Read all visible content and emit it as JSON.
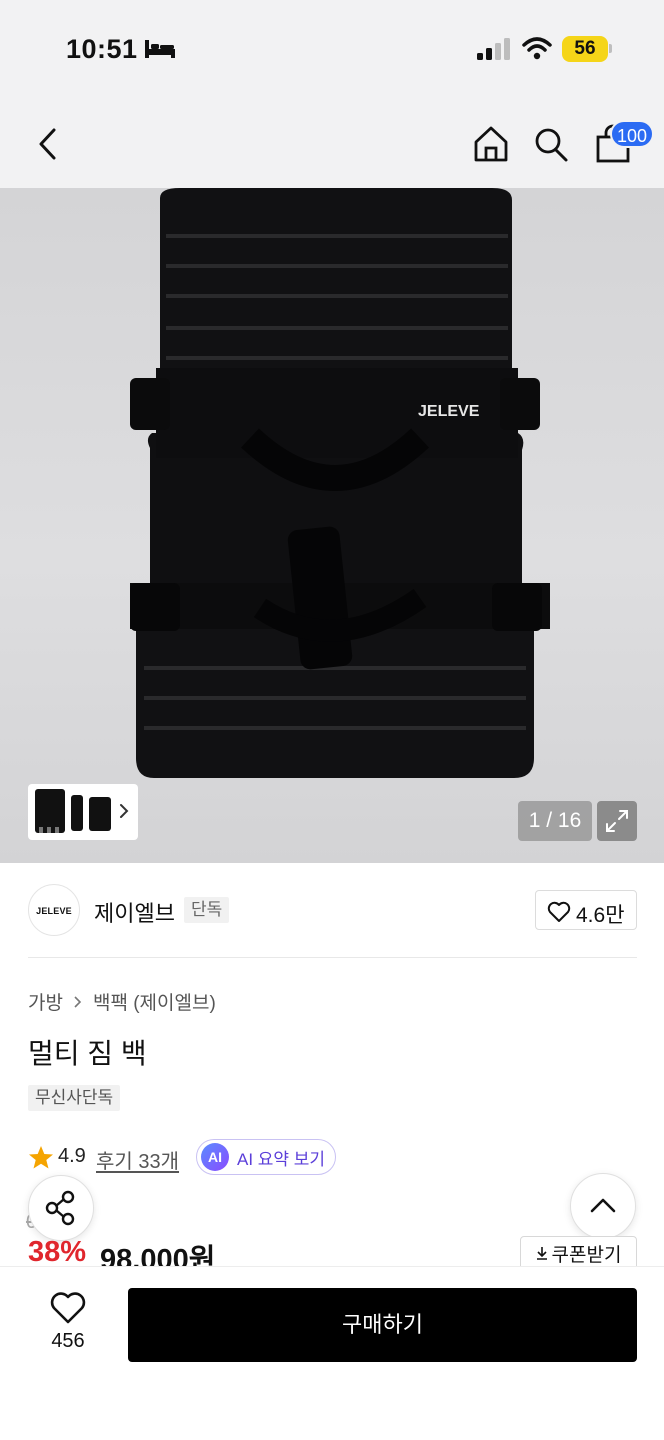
{
  "status_bar": {
    "time": "10:51",
    "battery_level": "56",
    "icons": [
      "bed-icon",
      "signal-icon",
      "wifi-icon",
      "battery-icon"
    ]
  },
  "header": {
    "icons": [
      "back-icon",
      "home-icon",
      "search-icon",
      "shopping-bag-icon"
    ],
    "cart_count": "100"
  },
  "gallery": {
    "brand_print": "JELEVE",
    "page_indicator": "1 / 16",
    "icons": [
      "chevron-right-icon",
      "expand-icon"
    ]
  },
  "brand": {
    "logo_text": "JELEVE",
    "name": "제이엘브",
    "exclusive_tag": "단독",
    "like_count": "4.6만"
  },
  "breadcrumb": {
    "category": "가방",
    "subcategory": "백팩 (제이엘브)"
  },
  "product": {
    "title": "멀티 짐 백",
    "tag": "무신사단독",
    "rating": "4.9",
    "reviews": "후기 33개",
    "ai_badge": "AI",
    "ai_summary_label": "AI 요약 보기",
    "original_price_visible": "0원",
    "discount": "38%",
    "sale_price": "98,000원",
    "coupon_label": "쿠폰받기"
  },
  "bottom_bar": {
    "wish_count": "456",
    "buy_label": "구매하기"
  },
  "colors": {
    "accent_blue": "#2b6bf3",
    "discount_red": "#e0262d",
    "star_orange": "#f5a400",
    "ai_purple": "#5b3fd9",
    "battery_yellow": "#f5d518"
  }
}
